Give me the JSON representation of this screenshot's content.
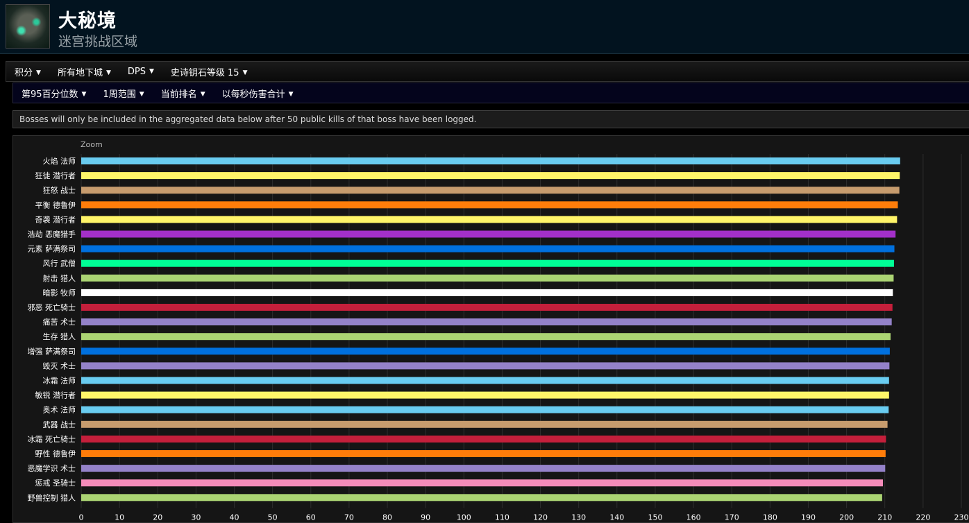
{
  "header": {
    "title": "大秘境",
    "subtitle": "迷宫挑战区域",
    "icon": "zone-emblem-icon"
  },
  "filters_row1": [
    {
      "label": "积分"
    },
    {
      "label": "所有地下城"
    },
    {
      "label": "DPS"
    },
    {
      "label": "史诗钥石等级 15"
    }
  ],
  "filters_row2": [
    {
      "label": "第95百分位数"
    },
    {
      "label": "1周范围"
    },
    {
      "label": "当前排名"
    },
    {
      "label": "以每秒伤害合计"
    }
  ],
  "notice": "Bosses will only be included in the aggregated data below after 50 public kills of that boss have been logged.",
  "chart_data": {
    "type": "bar",
    "orientation": "horizontal",
    "zoom_label": "Zoom",
    "xlim": [
      0,
      230
    ],
    "xticks": [
      0,
      10,
      20,
      30,
      40,
      50,
      60,
      70,
      80,
      90,
      100,
      110,
      120,
      130,
      140,
      150,
      160,
      170,
      180,
      190,
      200,
      210,
      220,
      230
    ],
    "grid": true,
    "categories": [
      "火焰 法师",
      "狂徒 潜行者",
      "狂怒 战士",
      "平衡 德鲁伊",
      "奇袭 潜行者",
      "浩劫 恶魔猎手",
      "元素 萨满祭司",
      "风行 武僧",
      "射击 猎人",
      "暗影 牧师",
      "邪恶 死亡骑士",
      "痛苦 术士",
      "生存 猎人",
      "增强 萨满祭司",
      "毁灭 术士",
      "冰霜 法师",
      "敏锐 潜行者",
      "奥术 法师",
      "武器 战士",
      "冰霜 死亡骑士",
      "野性 德鲁伊",
      "恶魔学识 术士",
      "惩戒 圣骑士",
      "野兽控制 猎人"
    ],
    "values": [
      214.0,
      213.9,
      213.8,
      213.4,
      213.2,
      212.8,
      212.5,
      212.4,
      212.3,
      212.1,
      212.0,
      211.8,
      211.5,
      211.3,
      211.2,
      211.1,
      211.1,
      211.0,
      210.7,
      210.3,
      210.2,
      210.1,
      209.5,
      209.3
    ],
    "colors": [
      "#69ccf0",
      "#fff569",
      "#c79c6e",
      "#ff7d0a",
      "#fff569",
      "#a330c9",
      "#0070de",
      "#00ff96",
      "#abd473",
      "#ffffff",
      "#c41f3b",
      "#9482c9",
      "#abd473",
      "#0070de",
      "#9482c9",
      "#69ccf0",
      "#fff569",
      "#69ccf0",
      "#c79c6e",
      "#c41f3b",
      "#ff7d0a",
      "#9482c9",
      "#f58cba",
      "#abd473"
    ]
  }
}
